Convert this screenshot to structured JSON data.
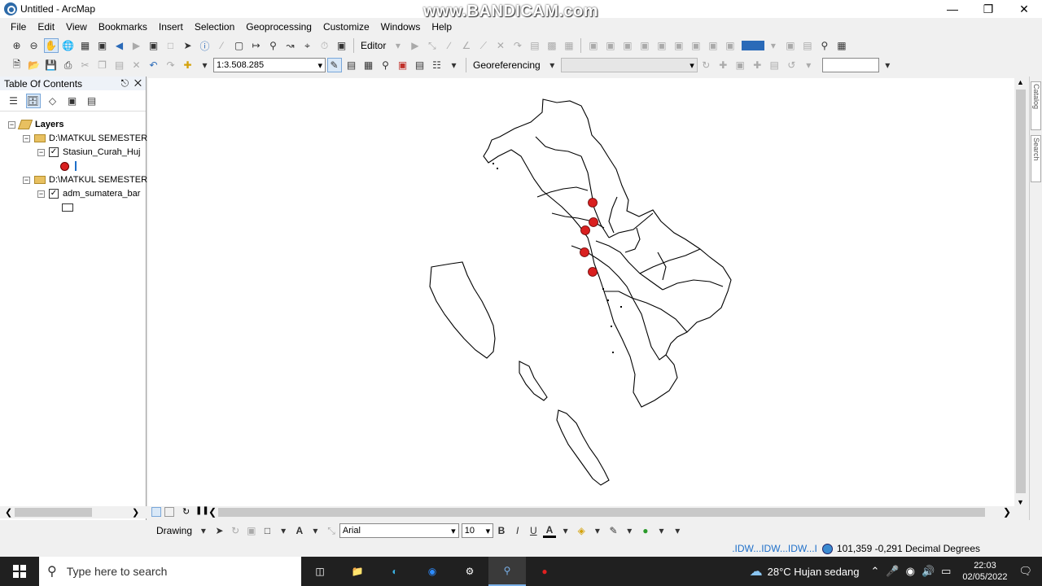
{
  "window": {
    "title": "Untitled - ArcMap",
    "watermark": "www.BANDICAM.com"
  },
  "menu": [
    "File",
    "Edit",
    "View",
    "Bookmarks",
    "Insert",
    "Selection",
    "Geoprocessing",
    "Customize",
    "Windows",
    "Help"
  ],
  "toolbar": {
    "editor_label": "Editor",
    "scale_value": "1:3.508.285",
    "georef_label": "Georeferencing"
  },
  "toc": {
    "title": "Table Of Contents",
    "root": "Layers",
    "group1": "D:\\MATKUL SEMESTER",
    "layer1": "Stasiun_Curah_Huj",
    "group2": "D:\\MATKUL SEMESTER",
    "layer2": "adm_sumatera_bar",
    "layer1_symbol_color": "#d92020"
  },
  "right_tabs": {
    "catalog": "Catalog",
    "search": "Search"
  },
  "drawing": {
    "label": "Drawing",
    "font": "Arial",
    "size": "10"
  },
  "status": {
    "idw": ".IDW...IDW...IDW...I",
    "coords": "101,359  -0,291 Decimal Degrees"
  },
  "taskbar": {
    "search_placeholder": "Type here to search",
    "weather": "28°C  Hujan sedang",
    "time": "22:03",
    "date": "02/05/2022"
  },
  "map_points": {
    "color": "#d92020",
    "count": 5
  }
}
